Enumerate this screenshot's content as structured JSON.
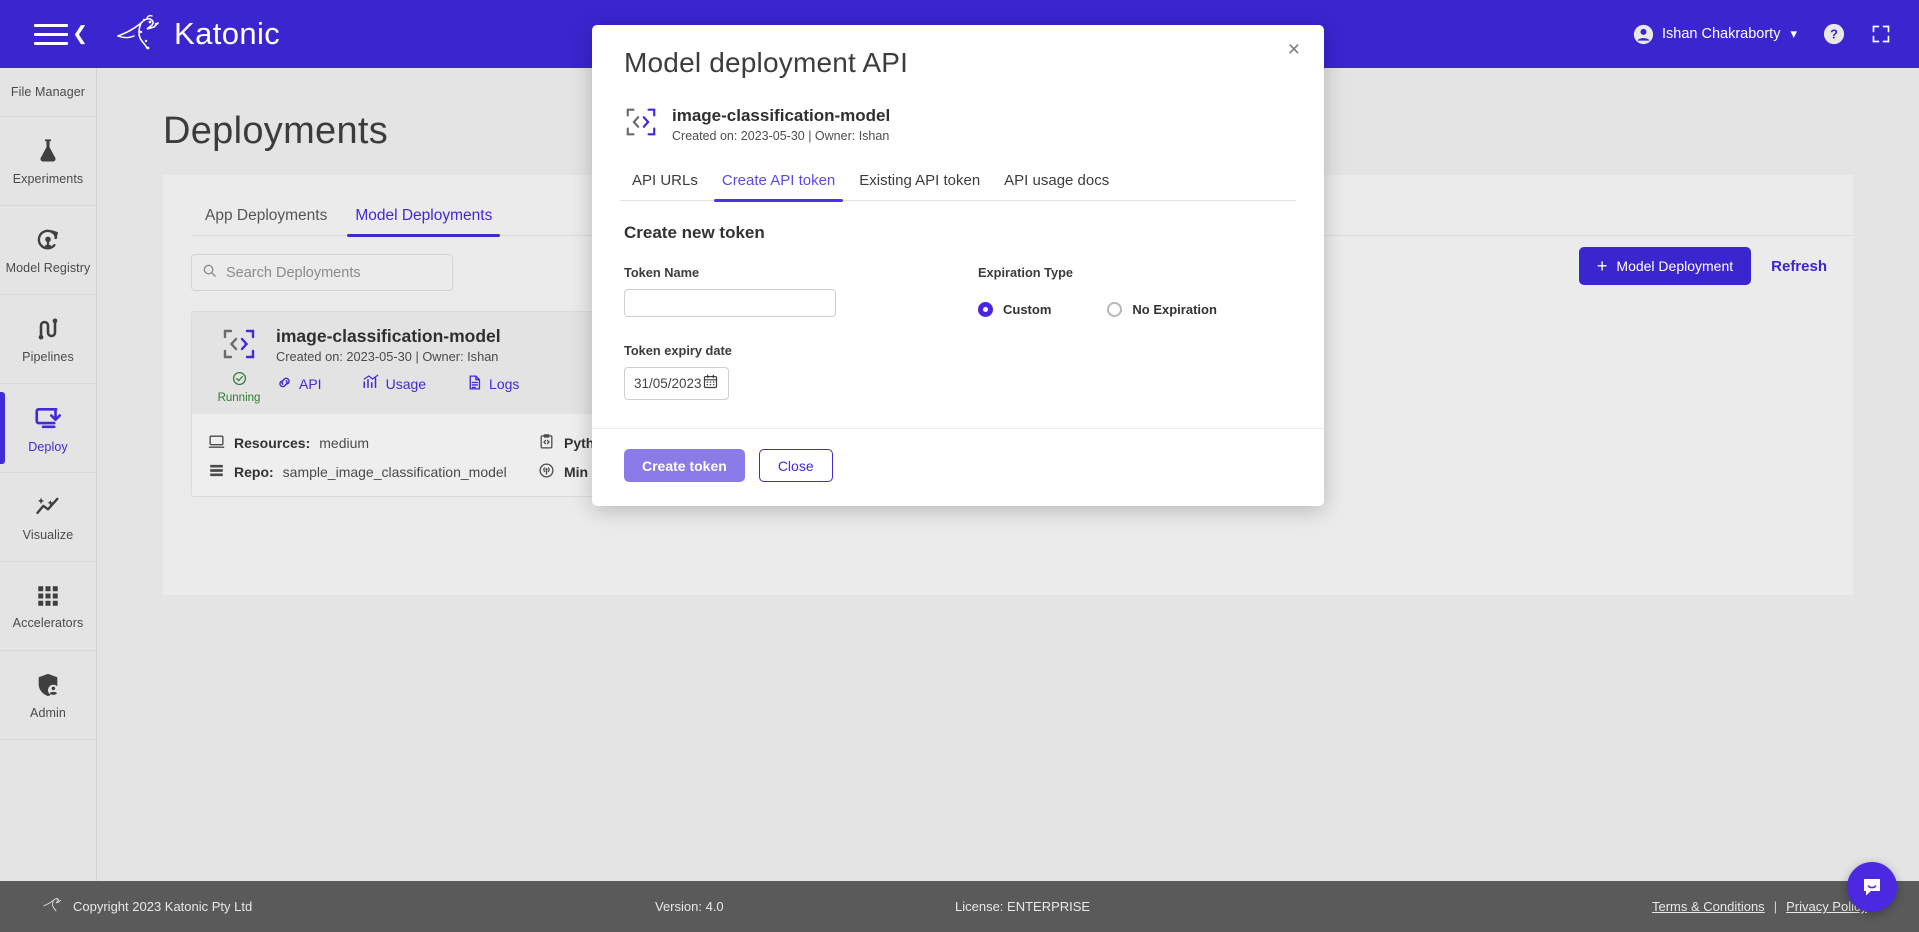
{
  "topbar": {
    "menu_icon": "hamburger-collapse-icon",
    "brand": "Katonic",
    "user_name": "Ishan Chakraborty",
    "help_icon": "help-circle-icon",
    "fullscreen_icon": "fullscreen-icon"
  },
  "sidebar": {
    "items": [
      {
        "label": "File Manager",
        "icon": "folder-icon",
        "active": false
      },
      {
        "label": "Experiments",
        "icon": "flask-icon",
        "active": false
      },
      {
        "label": "Model Registry",
        "icon": "model-registry-icon",
        "active": false
      },
      {
        "label": "Pipelines",
        "icon": "pipelines-icon",
        "active": false
      },
      {
        "label": "Deploy",
        "icon": "deploy-download-icon",
        "active": true
      },
      {
        "label": "Visualize",
        "icon": "visualize-sparkle-icon",
        "active": false
      },
      {
        "label": "Accelerators",
        "icon": "grid-apps-icon",
        "active": false
      },
      {
        "label": "Admin",
        "icon": "shield-user-icon",
        "active": false
      }
    ]
  },
  "main": {
    "page_title": "Deployments",
    "tabs": [
      {
        "label": "App Deployments",
        "active": false
      },
      {
        "label": "Model Deployments",
        "active": true
      }
    ],
    "search": {
      "placeholder": "Search Deployments",
      "value": "",
      "icon": "search-icon"
    },
    "add_button": {
      "label": "Model Deployment",
      "plus": "+"
    },
    "refresh_label": "Refresh",
    "card": {
      "icon": "code-brackets-icon",
      "title": "image-classification-model",
      "subtitle": "Created on: 2023-05-30 | Owner: Ishan",
      "status": {
        "label": "Running",
        "icon": "check-circle-icon",
        "color": "#2e7d32"
      },
      "links": [
        {
          "label": "API",
          "icon": "link-chain-icon"
        },
        {
          "label": "Usage",
          "icon": "usage-chart-icon"
        },
        {
          "label": "Logs",
          "icon": "logs-document-icon"
        }
      ],
      "meta": [
        {
          "key": "Resources:",
          "value": "medium",
          "icon": "monitor-icon",
          "key2": "Pyth",
          "value2": "",
          "icon2": "code-clipboard-icon"
        },
        {
          "key": "Repo:",
          "value": "sample_image_classification_model",
          "icon": "server-stack-icon",
          "key2": "Min",
          "value2": "",
          "icon2": "broadcast-icon"
        }
      ]
    }
  },
  "modal": {
    "title": "Model deployment API",
    "close_icon": "close-x-icon",
    "model": {
      "icon": "code-brackets-icon",
      "name": "image-classification-model",
      "meta": "Created on: 2023-05-30 | Owner: Ishan"
    },
    "tabs": [
      {
        "label": "API URLs",
        "active": false
      },
      {
        "label": "Create API token",
        "active": true
      },
      {
        "label": "Existing API token",
        "active": false
      },
      {
        "label": "API usage docs",
        "active": false
      }
    ],
    "section_title": "Create new token",
    "token_name": {
      "label": "Token Name",
      "value": "",
      "placeholder": ""
    },
    "expiration": {
      "label": "Expiration Type",
      "options": [
        {
          "label": "Custom",
          "selected": true
        },
        {
          "label": "No Expiration",
          "selected": false
        }
      ]
    },
    "expiry": {
      "label": "Token expiry date",
      "value": "31/05/2023",
      "icon": "calendar-icon"
    },
    "footer": {
      "create_label": "Create token",
      "close_label": "Close"
    }
  },
  "footer": {
    "copyright": "Copyright 2023 Katonic Pty Ltd",
    "version": "Version: 4.0",
    "license": "License: ENTERPRISE",
    "terms": "Terms & Conditions",
    "separator": "|",
    "privacy": "Privacy Policy"
  },
  "chat": {
    "icon": "chat-bubble-icon"
  },
  "colors": {
    "brand_purple": "#3a25cf",
    "accent_purple": "#4029d6",
    "tab_purple": "#5b4ae8",
    "button_light_purple": "#8a7ce8",
    "status_green": "#2e7d32",
    "footer_gray": "#5a5a5a",
    "page_bg": "#e4e4e4"
  }
}
